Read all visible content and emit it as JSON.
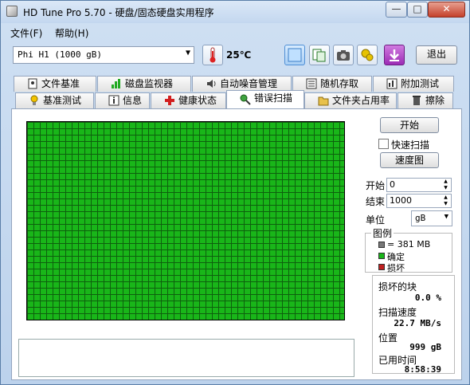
{
  "window": {
    "title": "HD Tune Pro 5.70 - 硬盘/固态硬盘实用程序"
  },
  "menu": [
    "文件(F)",
    "帮助(H)"
  ],
  "toolbar": {
    "drive": "Phi      H1  (1000 gB)",
    "temperature": "25℃",
    "exit_label": "退出",
    "icons": [
      "thermometer-icon",
      "save-screen-icon",
      "copy-icon",
      "camera-icon",
      "settings-icon",
      "download-icon"
    ]
  },
  "tabs_row1": [
    "文件基准",
    "磁盘监视器",
    "自动噪音管理",
    "随机存取",
    "附加测试"
  ],
  "tabs_row2": [
    "基准测试",
    "信息",
    "健康状态",
    "错误扫描",
    "文件夹占用率",
    "擦除"
  ],
  "active_tab": "错误扫描",
  "scan": {
    "start_button": "开始",
    "quick_scan_label": "快速扫描",
    "quick_scan_checked": false,
    "speed_map_button": "速度图",
    "start_label": "开始",
    "start_value": "0",
    "end_label": "结束",
    "end_value": "1000",
    "unit_label": "单位",
    "unit_value": "gB"
  },
  "legend": {
    "title": "图例",
    "block_size": "= 381 MB",
    "ok_label": "确定",
    "damaged_label": "损坏",
    "colors": {
      "grid": "#444444",
      "ok": "#19b619",
      "damaged": "#c02020"
    }
  },
  "stats": {
    "damaged_blocks_label": "损坏的块",
    "damaged_blocks_value": "0.0 %",
    "scan_speed_label": "扫描速度",
    "scan_speed_value": "22.7 MB/s",
    "position_label": "位置",
    "position_value": "999 gB",
    "elapsed_label": "已用时间",
    "elapsed_value": "8:58:39"
  }
}
